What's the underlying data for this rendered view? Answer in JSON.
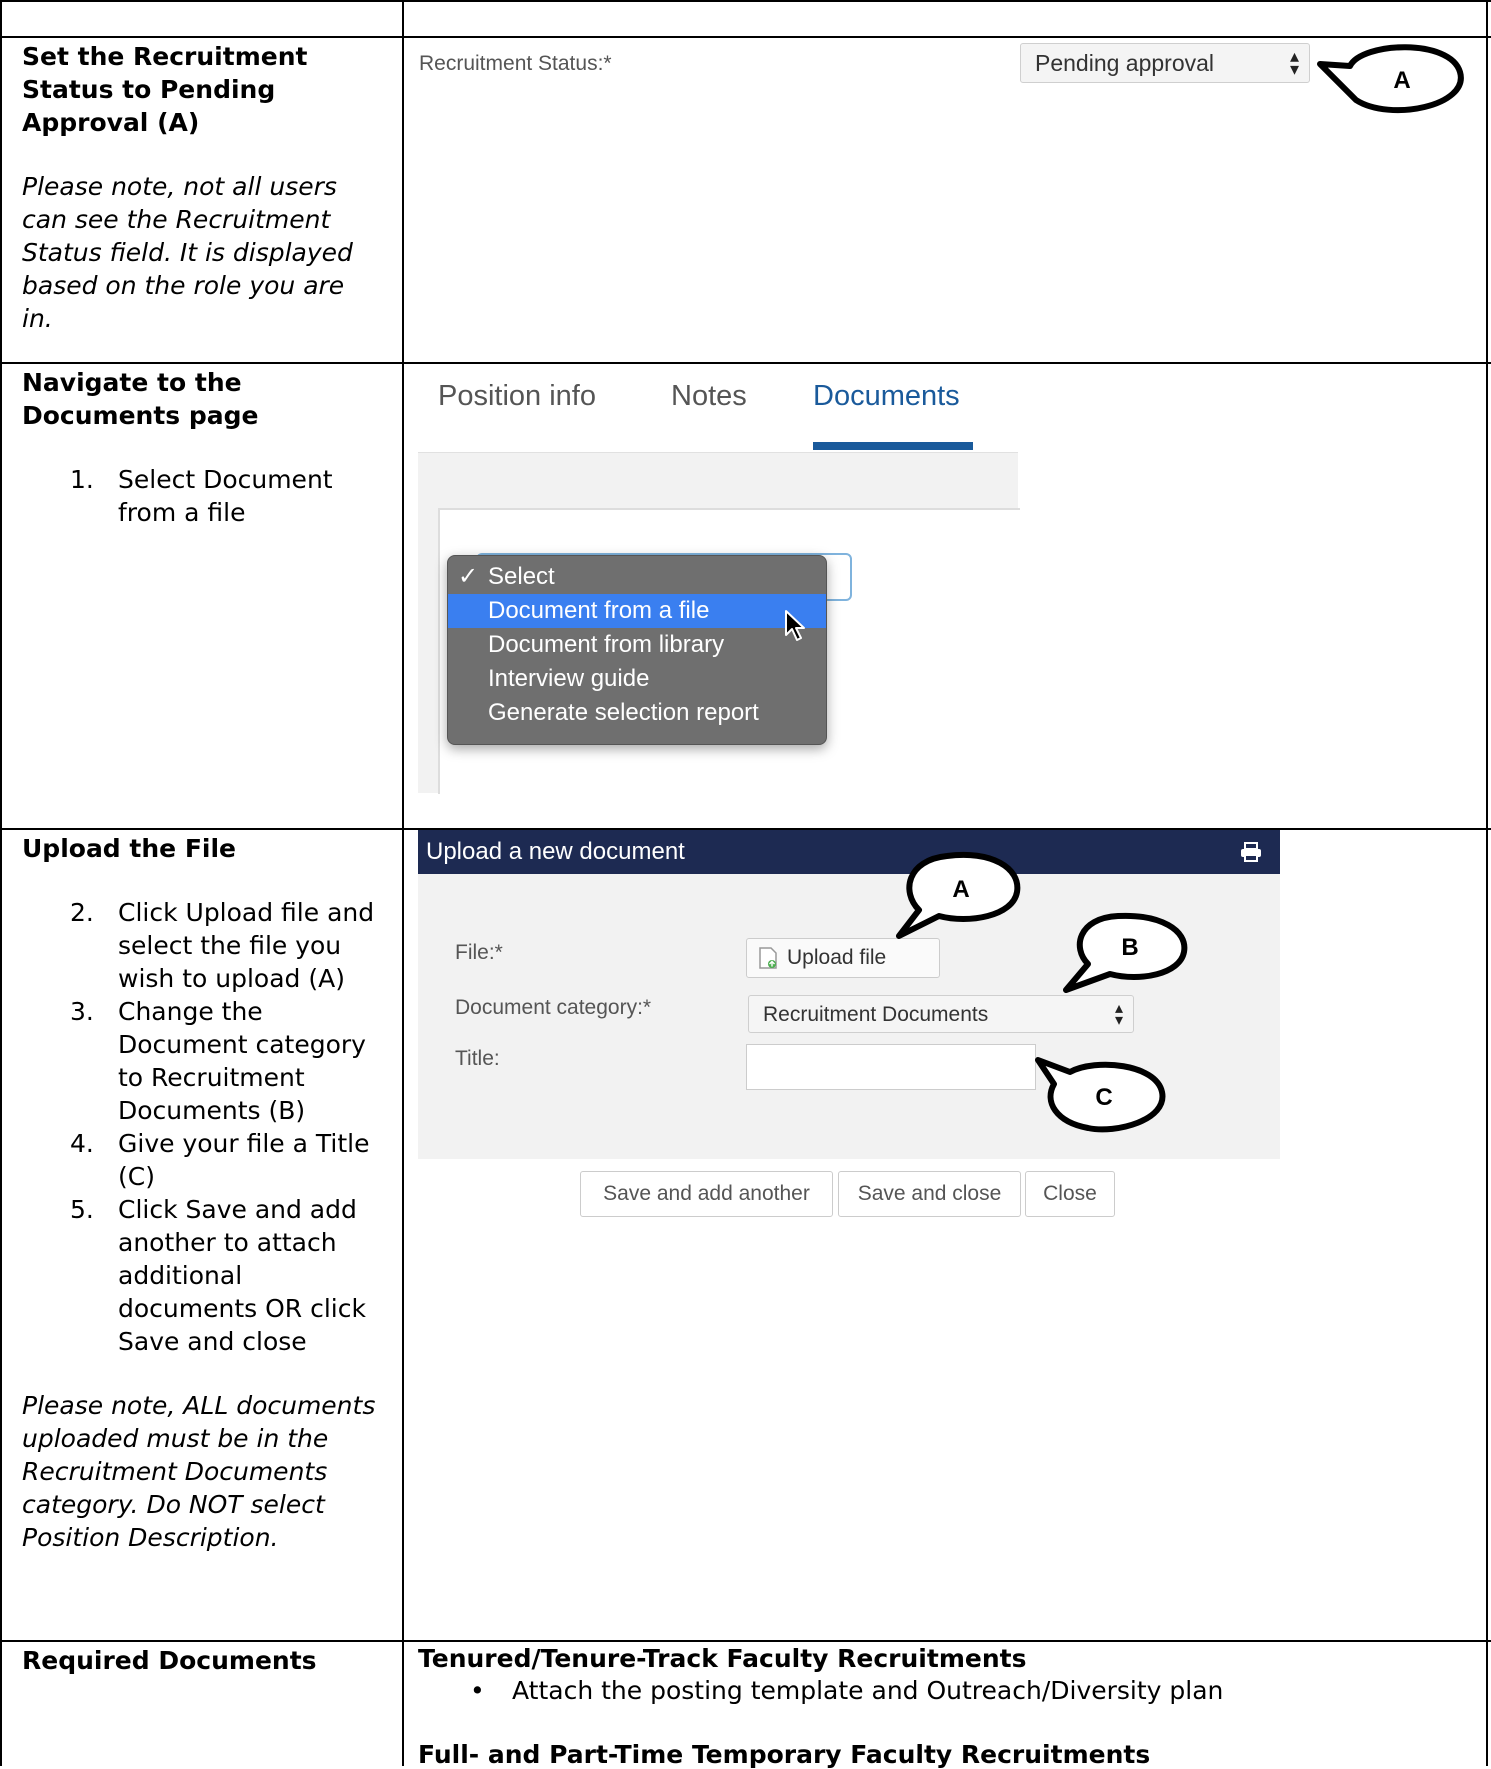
{
  "rows": [
    {
      "heading": "Set the Recruitment Status to Pending Approval (A)",
      "note": "Please note, not all users can see the Recruitment Status field. It is displayed based on the role you are in."
    },
    {
      "heading": "Navigate to the Documents page",
      "steps": [
        {
          "num": "1.",
          "text": "Select Document from a file"
        }
      ]
    },
    {
      "heading": "Upload the File",
      "steps": [
        {
          "num": "2.",
          "text": "Click Upload file and select the file you wish to upload (A)"
        },
        {
          "num": "3.",
          "text": "Change the Document category to Recruitment Documents (B)"
        },
        {
          "num": "4.",
          "text": "Give your file a Title (C)"
        },
        {
          "num": "5.",
          "text": "Click Save and add another to attach additional documents OR click Save and close"
        }
      ],
      "note": "Please note, ALL documents uploaded must be in the Recruitment Documents category. Do NOT select Position Description."
    },
    {
      "heading": "Required Documents"
    }
  ],
  "status_screenshot": {
    "label": "Recruitment Status:*",
    "selected": "Pending approval",
    "callout": "A"
  },
  "documents_screenshot": {
    "tabs": [
      "Position info",
      "Notes",
      "Documents"
    ],
    "active_tab": "Documents",
    "menu_items": [
      "Select",
      "Document from a file",
      "Document from library",
      "Interview guide",
      "Generate selection report"
    ],
    "checked_item": "Select",
    "highlighted_item": "Document from a file"
  },
  "upload_screenshot": {
    "title": "Upload a new document",
    "file_label": "File:*",
    "upload_button": "Upload file",
    "category_label": "Document category:*",
    "category_value": "Recruitment Documents",
    "title_label": "Title:",
    "title_value": "",
    "buttons": [
      "Save and add another",
      "Save and close",
      "Close"
    ],
    "callouts": [
      "A",
      "B",
      "C"
    ]
  },
  "required": {
    "group1_title": "Tenured/Tenure-Track Faculty Recruitments",
    "group1_bullet": "Attach the posting template and Outreach/Diversity plan",
    "group2_title": "Full- and Part-Time Temporary Faculty Recruitments"
  },
  "colors": {
    "tab_active": "#1a5a9b",
    "modal_header": "#1d2a52",
    "menu_bg": "#6f6f6f",
    "menu_highlight": "#3a7ff0"
  }
}
